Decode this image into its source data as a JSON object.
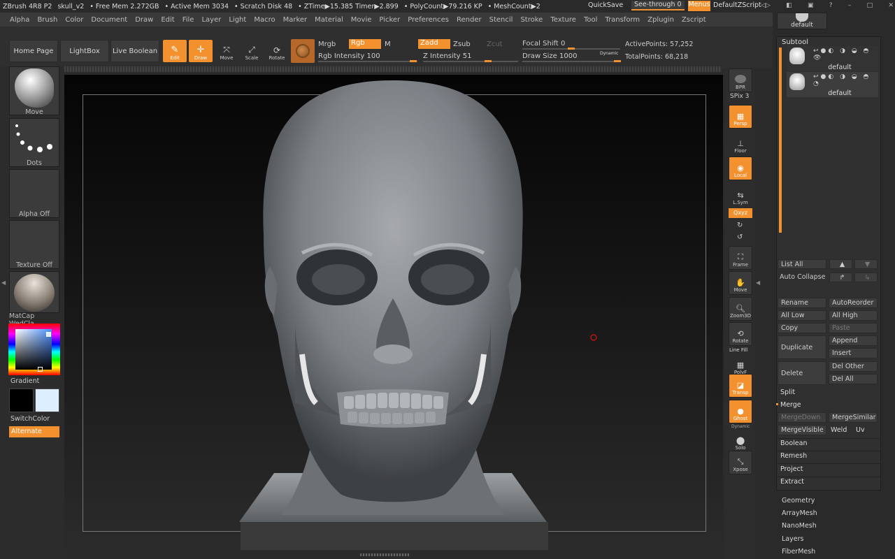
{
  "titlebar": {
    "app": "ZBrush 4R8 P2",
    "doc": "skull_v2",
    "free_mem": "• Free Mem 2.272GB",
    "active_mem": "• Active Mem 3034",
    "scratch": "• Scratch Disk 48",
    "ztime": "• ZTime▶15.385 Timer▶2.899",
    "polycount": "• PolyCount▶79.216 KP",
    "meshcount": "• MeshCount▶2",
    "quicksave": "QuickSave",
    "seethrough": "See-through  0",
    "menus": "Menus",
    "zscript": "DefaultZScript"
  },
  "menus": [
    "Alpha",
    "Brush",
    "Color",
    "Document",
    "Draw",
    "Edit",
    "File",
    "Layer",
    "Light",
    "Macro",
    "Marker",
    "Material",
    "Movie",
    "Picker",
    "Preferences",
    "Render",
    "Stencil",
    "Stroke",
    "Texture",
    "Tool",
    "Transform",
    "Zplugin",
    "Zscript"
  ],
  "toolbar": {
    "home": "Home Page",
    "lightbox": "LightBox",
    "liveboolean": "Live Boolean",
    "edit": "Edit",
    "draw": "Draw",
    "move": "Move",
    "scale": "Scale",
    "rotate": "Rotate",
    "mrgb": "Mrgb",
    "rgb": "Rgb",
    "m": "M",
    "zadd": "Zadd",
    "zsub": "Zsub",
    "zcut": "Zcut",
    "rgb_intensity": "Rgb Intensity 100",
    "z_intensity": "Z Intensity 51",
    "focal_shift": "Focal Shift 0",
    "draw_size": "Draw Size 1000",
    "dynamic": "Dynamic",
    "active_points": "ActivePoints: 57,252",
    "total_points": "TotalPoints: 68,218"
  },
  "left": {
    "move": "Move",
    "dots": "Dots",
    "alpha": "Alpha Off",
    "texture": "Texture Off",
    "matcap": "MatCap WedCla",
    "gradient": "Gradient",
    "switchcolor": "SwitchColor",
    "alternate": "Alternate"
  },
  "righttools": {
    "bpr": "BPR",
    "spix": "SPix 3",
    "persp": "Persp",
    "floor": "Floor",
    "local": "Local",
    "lsym": "L.Sym",
    "xyz": "Qxyz",
    "frame": "Frame",
    "move": "Move",
    "zoom": "Zoom3D",
    "rotate": "Rotate",
    "linefill": "Line Fill",
    "polyf": "PolyF",
    "transp": "Transp",
    "ghost": "Ghost",
    "dynamic": "Dynamic",
    "solo": "Solo",
    "xpose": "Xpose"
  },
  "subtool": {
    "top_default": "default",
    "title": "Subtool",
    "items": [
      "default",
      "default"
    ],
    "list_all": "List All",
    "auto_collapse": "Auto Collapse",
    "rename": "Rename",
    "autoreorder": "AutoReorder",
    "all_low": "All Low",
    "all_high": "All High",
    "copy": "Copy",
    "paste": "Paste",
    "duplicate": "Duplicate",
    "append": "Append",
    "insert": "Insert",
    "delete": "Delete",
    "del_other": "Del Other",
    "del_all": "Del All",
    "split": "Split",
    "merge": "Merge",
    "mergedown": "MergeDown",
    "mergesimilar": "MergeSimilar",
    "mergevisible": "MergeVisible",
    "weld": "Weld",
    "uv": "Uv",
    "boolean": "Boolean",
    "remesh": "Remesh",
    "project": "Project",
    "extract": "Extract"
  },
  "tool_sections": [
    "Geometry",
    "ArrayMesh",
    "NanoMesh",
    "Layers",
    "FiberMesh"
  ]
}
